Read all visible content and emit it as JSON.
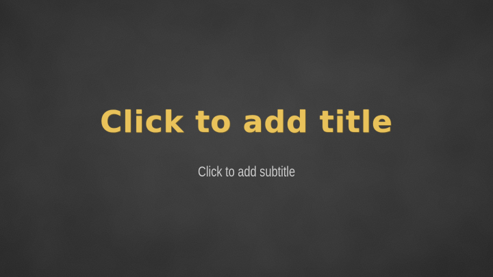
{
  "slide": {
    "title_placeholder": "Click to add title",
    "subtitle_placeholder": "Click to add subtitle"
  },
  "theme": {
    "background": "#2f2f2f",
    "title_color": "#e9c25a",
    "subtitle_color": "#d8d8d8",
    "style": "chalkboard"
  }
}
